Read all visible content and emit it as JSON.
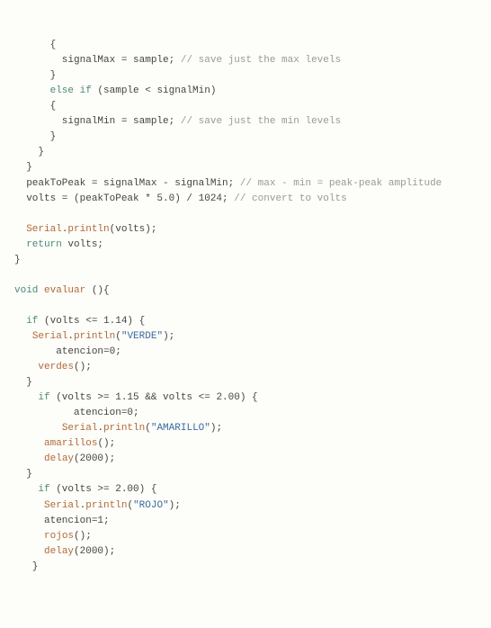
{
  "code": {
    "l01_a": "      {",
    "l02_a": "        signalMax = sample; ",
    "l02_c": "// save just the max levels",
    "l03_a": "      }",
    "l04_a": "      ",
    "l04_k": "else if",
    "l04_b": " (sample < signalMin)",
    "l05_a": "      {",
    "l06_a": "        signalMin = sample; ",
    "l06_c": "// save just the min levels",
    "l07_a": "      }",
    "l08_a": "    }",
    "l09_a": "  }",
    "l10_a": "  peakToPeak = signalMax - signalMin; ",
    "l10_c": "// max - min = peak-peak amplitude",
    "l11_a": "  volts = (peakToPeak * 5.0) / 1024; ",
    "l11_c": "// convert to volts",
    "l13_obj": "Serial",
    "l13_fn": "println",
    "l13_arg": "(volts);",
    "l14_k": "return",
    "l14_b": " volts;",
    "l15_a": "}",
    "l17_k": "void",
    "l17_fn": "evaluar",
    "l17_b": " (){",
    "l19_k": "if",
    "l19_b": " (volts <= 1.14) {",
    "l20_obj": "Serial",
    "l20_fn": "println",
    "l20_p": "(",
    "l20_s": "\"VERDE\"",
    "l20_e": ");",
    "l21_a": "       atencion=0;",
    "l22_fn": "verdes",
    "l22_b": "();",
    "l23_a": "  }",
    "l24_k": "if",
    "l24_b": " (volts >= 1.15 && volts <= 2.00) {",
    "l25_a": "          atencion=0;",
    "l26_obj": "Serial",
    "l26_fn": "println",
    "l26_p": "(",
    "l26_s": "\"AMARILLO\"",
    "l26_e": ");",
    "l27_fn": "amarillos",
    "l27_b": "();",
    "l28_fn": "delay",
    "l28_b": "(2000);",
    "l29_a": "  }",
    "l30_k": "if",
    "l30_b": " (volts >= 2.00) {",
    "l31_obj": "Serial",
    "l31_fn": "println",
    "l31_p": "(",
    "l31_s": "\"ROJO\"",
    "l31_e": ");",
    "l32_a": "     atencion=1;",
    "l33_fn": "rojos",
    "l33_b": "();",
    "l34_fn": "delay",
    "l34_b": "(2000);",
    "l35_a": "   }"
  }
}
